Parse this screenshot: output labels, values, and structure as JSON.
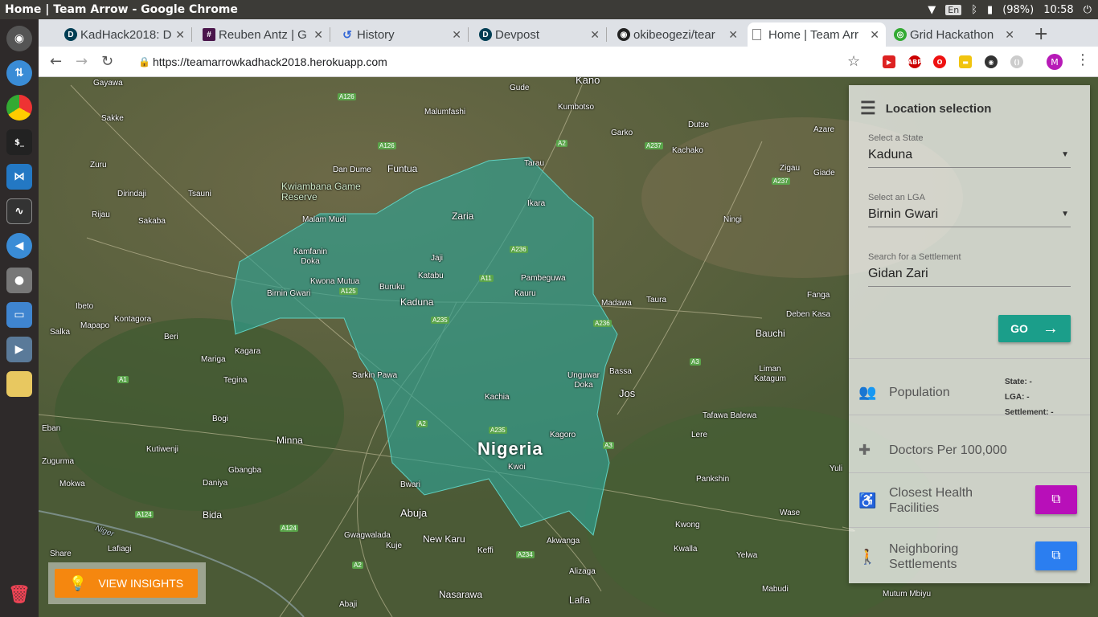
{
  "os": {
    "window_title": "Home | Team Arrow - Google Chrome",
    "keyboard": "En",
    "battery": "(98%)",
    "time": "10:58"
  },
  "browser": {
    "tabs": [
      {
        "title": "KadHack2018: D",
        "icon": "devpost-icon"
      },
      {
        "title": "Reuben Antz | G",
        "icon": "slack-icon"
      },
      {
        "title": "History",
        "icon": "history-icon"
      },
      {
        "title": "Devpost",
        "icon": "devpost-icon"
      },
      {
        "title": "okibeogezi/tear",
        "icon": "github-icon"
      },
      {
        "title": "Home | Team Arr",
        "icon": "page-icon"
      },
      {
        "title": "Grid Hackathon",
        "icon": "globe-icon"
      }
    ],
    "url": "https://teamarrowkadhack2018.herokuapp.com",
    "profile_initial": "M"
  },
  "map": {
    "country": "Nigeria",
    "places": [
      {
        "name": "Gayawa"
      },
      {
        "name": "Kano"
      },
      {
        "name": "Gude"
      },
      {
        "name": "Malumfashi"
      },
      {
        "name": "Kumbotso"
      },
      {
        "name": "Sakke"
      },
      {
        "name": "Garko"
      },
      {
        "name": "Dutse"
      },
      {
        "name": "Azare"
      },
      {
        "name": "Kachako"
      },
      {
        "name": "Zuru"
      },
      {
        "name": "Dan Dume"
      },
      {
        "name": "Funtua"
      },
      {
        "name": "Tarau"
      },
      {
        "name": "Zigau"
      },
      {
        "name": "Giade"
      },
      {
        "name": "Dirindaji"
      },
      {
        "name": "Tsauni"
      },
      {
        "name": "Kwiambana Game Reserve"
      },
      {
        "name": "Rijau"
      },
      {
        "name": "Sakaba"
      },
      {
        "name": "Malam Mudi"
      },
      {
        "name": "Zaria"
      },
      {
        "name": "Ikara"
      },
      {
        "name": "Ningi"
      },
      {
        "name": "Kamfanin Doka"
      },
      {
        "name": "Jaji"
      },
      {
        "name": "Katabu"
      },
      {
        "name": "Pambeguwa"
      },
      {
        "name": "Kwona Mutua"
      },
      {
        "name": "Buruku"
      },
      {
        "name": "Kauru"
      },
      {
        "name": "Birnin Gwari"
      },
      {
        "name": "Kaduna"
      },
      {
        "name": "Madawa"
      },
      {
        "name": "Taura"
      },
      {
        "name": "Ibeto"
      },
      {
        "name": "Kontagora"
      },
      {
        "name": "Mapapo"
      },
      {
        "name": "Salka"
      },
      {
        "name": "Beri"
      },
      {
        "name": "Fanga"
      },
      {
        "name": "Deben Kasa"
      },
      {
        "name": "Bauchi"
      },
      {
        "name": "Kagara"
      },
      {
        "name": "Mariga"
      },
      {
        "name": "Tegina"
      },
      {
        "name": "Sarkin Pawa"
      },
      {
        "name": "Bassa"
      },
      {
        "name": "Unguwar Doka"
      },
      {
        "name": "Jos"
      },
      {
        "name": "Liman Katagum"
      },
      {
        "name": "Kachia"
      },
      {
        "name": "Eban"
      },
      {
        "name": "Bogi"
      },
      {
        "name": "Kutiwenji"
      },
      {
        "name": "Minna"
      },
      {
        "name": "Tafawa Balewa"
      },
      {
        "name": "Kagoro"
      },
      {
        "name": "Lere"
      },
      {
        "name": "Zugurma"
      },
      {
        "name": "Gbangba"
      },
      {
        "name": "Kwoi"
      },
      {
        "name": "Mokwa"
      },
      {
        "name": "Daniya"
      },
      {
        "name": "Bwari"
      },
      {
        "name": "Pankshin"
      },
      {
        "name": "Yuli"
      },
      {
        "name": "Bida"
      },
      {
        "name": "Abuja"
      },
      {
        "name": "Wase"
      },
      {
        "name": "Gwagwalada"
      },
      {
        "name": "New Karu"
      },
      {
        "name": "Kwong"
      },
      {
        "name": "Lafiagi"
      },
      {
        "name": "Kuje"
      },
      {
        "name": "Keffi"
      },
      {
        "name": "Akwanga"
      },
      {
        "name": "Kwalla"
      },
      {
        "name": "Share"
      },
      {
        "name": "Yelwa"
      },
      {
        "name": "Alizaga"
      },
      {
        "name": "Nasarawa"
      },
      {
        "name": "Mabudi"
      },
      {
        "name": "Abaji"
      },
      {
        "name": "Lafia"
      },
      {
        "name": "Mutum Mbiyu"
      },
      {
        "name": "Niger"
      }
    ],
    "roads": [
      "A126",
      "A126",
      "A2",
      "A237",
      "A237",
      "A236",
      "A11",
      "A125",
      "A235",
      "A236",
      "A3",
      "A1",
      "A2",
      "A235",
      "A3",
      "A124",
      "A124",
      "A234",
      "A2"
    ]
  },
  "panel": {
    "title": "Location selection",
    "state_label": "Select a State",
    "state_value": "Kaduna",
    "lga_label": "Select an LGA",
    "lga_value": "Birnin Gwari",
    "settlement_label": "Search for a Settlement",
    "settlement_value": "Gidan Zari",
    "go_label": "GO",
    "population_label": "Population",
    "state_stat": "State: -",
    "lga_stat": "LGA: -",
    "settlement_stat": "Settlement: -",
    "doctors_label": "Doctors Per 100,000",
    "health_label": "Closest Health Facilities",
    "neighbors_label": "Neighboring Settlements",
    "accent_health": "#b80fb9",
    "accent_neighbors": "#2b7ef0"
  },
  "insights": {
    "label": "VIEW INSIGHTS"
  },
  "colors": {
    "state_fill": "#2fa192",
    "go": "#1b9e8a",
    "insights": "#f5870f"
  }
}
